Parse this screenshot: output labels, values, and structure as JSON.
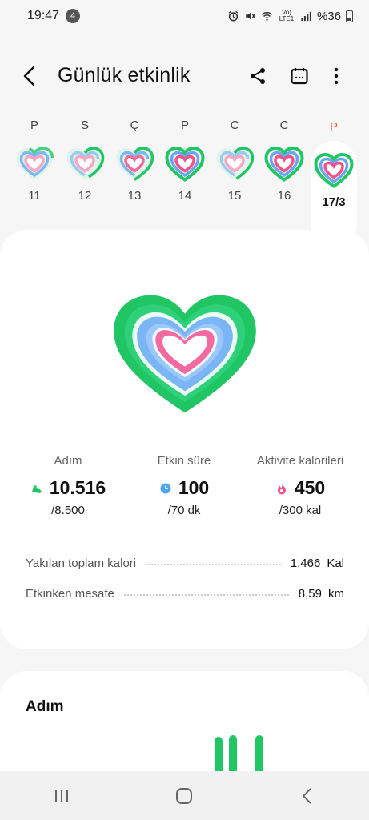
{
  "status_bar": {
    "time": "19:47",
    "notification_count": "4",
    "network_label": "Vo) LTE1",
    "battery_text": "%36"
  },
  "app_bar": {
    "title": "Günlük etkinlik",
    "back_icon": "back-arrow-icon",
    "share_icon": "share-icon",
    "calendar_icon": "calendar-icon",
    "more_icon": "more-vertical-icon"
  },
  "days": [
    {
      "letter": "P",
      "number": "11",
      "complete": false
    },
    {
      "letter": "S",
      "number": "12",
      "complete": false
    },
    {
      "letter": "Ç",
      "number": "13",
      "complete": false
    },
    {
      "letter": "P",
      "number": "14",
      "complete": true
    },
    {
      "letter": "C",
      "number": "15",
      "complete": false
    },
    {
      "letter": "C",
      "number": "16",
      "complete": true
    },
    {
      "letter": "P",
      "number": "17/3",
      "complete": true,
      "selected": true
    }
  ],
  "colors": {
    "steps": "#21c664",
    "active_time": "#4ea6f0",
    "calories": "#f0538a",
    "sunday_red": "#e85c4a"
  },
  "summary": {
    "steps": {
      "label": "Adım",
      "value": "10.516",
      "goal": "/8.500",
      "icon": "shoe-icon"
    },
    "active_time": {
      "label": "Etkin süre",
      "value": "100",
      "goal": "/70 dk",
      "icon": "clock-icon"
    },
    "calories": {
      "label": "Aktivite kalorileri",
      "value": "450",
      "goal": "/300 kal",
      "icon": "flame-icon"
    }
  },
  "details": {
    "total_calories": {
      "label": "Yakılan toplam kalori",
      "value": "1.466",
      "unit": "Kal"
    },
    "distance": {
      "label": "Etkinken mesafe",
      "value": "8,59",
      "unit": "km"
    }
  },
  "steps_card": {
    "title": "Adım"
  },
  "nav": {
    "recents_icon": "recents-icon",
    "home_icon": "home-icon",
    "back_icon": "back-chevron-icon"
  }
}
